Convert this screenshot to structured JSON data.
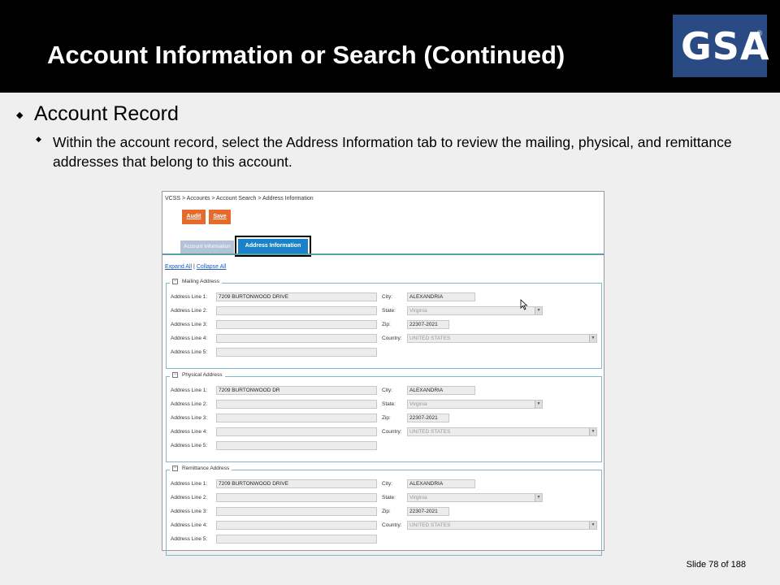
{
  "header": {
    "title": "Account Information or Search (Continued)"
  },
  "logo": {
    "text": "GSA",
    "reg": "®"
  },
  "bullets": {
    "level1": "Account Record",
    "level2": "Within the account record, select the Address Information tab to review the mailing, physical, and remittance addresses that belong to this account."
  },
  "app": {
    "breadcrumb": "VCSS  >  Accounts  >  Account Search  >  Address Information",
    "buttons": {
      "audit": "Audit",
      "save": "Save"
    },
    "tabs": {
      "account": "Account Information",
      "address": "Address Information"
    },
    "expand_all": "Expand All",
    "separator": "|",
    "collapse_all": "Collapse All",
    "labels": {
      "line1": "Address Line 1:",
      "line2": "Address Line 2:",
      "line3": "Address Line 3:",
      "line4": "Address Line 4:",
      "line5": "Address Line 5:",
      "city": "City:",
      "state": "State:",
      "zip": "Zip:",
      "country": "Country:"
    },
    "sections": [
      {
        "title": "Mailing Address",
        "line1": "7209 BURTONWOOD DRIVE",
        "city": "ALEXANDRIA",
        "state": "Virginia",
        "zip": "22307-2021",
        "country": "UNITED STATES"
      },
      {
        "title": "Physical Address",
        "line1": "7209 BURTONWOOD DR",
        "city": "ALEXANDRIA",
        "state": "Virginia",
        "zip": "22307-2021",
        "country": "UNITED STATES"
      },
      {
        "title": "Remittance Address",
        "line1": "7209 BURTONWOOD DRIVE",
        "city": "ALEXANDRIA",
        "state": "Virginia",
        "zip": "22307-2021",
        "country": "UNITED STATES"
      }
    ]
  },
  "footer": {
    "slide": "Slide 78 of 188"
  }
}
